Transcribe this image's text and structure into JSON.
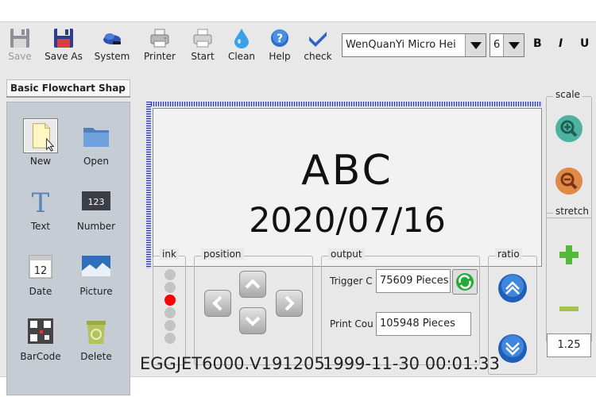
{
  "toolbar": {
    "items": [
      {
        "label": "Save",
        "icon": "floppy-disk-icon",
        "enabled": false
      },
      {
        "label": "Save As",
        "icon": "floppy-disk-red-icon",
        "enabled": true
      },
      {
        "label": "System",
        "icon": "system-tools-icon",
        "enabled": true
      },
      {
        "label": "Printer",
        "icon": "printer-icon",
        "enabled": true
      },
      {
        "label": "Start",
        "icon": "start-printer-icon",
        "enabled": true
      },
      {
        "label": "Clean",
        "icon": "water-drop-icon",
        "enabled": true
      },
      {
        "label": "Help",
        "icon": "help-icon",
        "enabled": true
      },
      {
        "label": "check",
        "icon": "checkmark-icon",
        "enabled": true
      }
    ],
    "font_name": "WenQuanYi Micro Hei",
    "font_size": "6",
    "bold_label": "B",
    "italic_label": "I",
    "underline_label": "U"
  },
  "left_panel": {
    "tab_label": "Basic Flowchart Shap",
    "tools": [
      {
        "label": "New",
        "icon": "new-file-icon",
        "selected": true
      },
      {
        "label": "Open",
        "icon": "folder-icon",
        "selected": false
      },
      {
        "label": "Text",
        "icon": "text-icon",
        "selected": false
      },
      {
        "label": "Number",
        "icon": "number-icon",
        "selected": false,
        "icon_text": "123"
      },
      {
        "label": "Date",
        "icon": "calendar-icon",
        "selected": false,
        "icon_text": "12"
      },
      {
        "label": "Picture",
        "icon": "picture-icon",
        "selected": false
      },
      {
        "label": "BarCode",
        "icon": "qr-code-icon",
        "selected": false
      },
      {
        "label": "Delete",
        "icon": "recycle-bin-icon",
        "selected": false
      }
    ]
  },
  "canvas": {
    "line1": "ABC",
    "line2": "2020/07/16"
  },
  "ink": {
    "title": "ink",
    "levels": 6,
    "active_index": 2,
    "active_color": "#ff0000"
  },
  "position": {
    "title": "position"
  },
  "output": {
    "title": "output",
    "trigger_label": "Trigger C",
    "trigger_value": "75609  Pieces",
    "print_label": "Print Cou",
    "print_value": "105948  Pieces"
  },
  "ratio": {
    "title": "ratio"
  },
  "scale": {
    "title": "scale"
  },
  "stretch": {
    "title": "stretch",
    "value": "1.25"
  },
  "status": {
    "version": "EGGJET6000.V191205",
    "datetime": "1999-11-30 00:01:33"
  }
}
